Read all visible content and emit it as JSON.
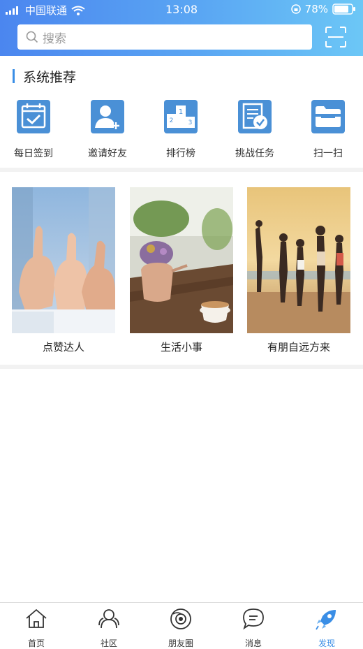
{
  "status": {
    "carrier": "中国联通",
    "time": "13:08",
    "battery": "78%"
  },
  "search": {
    "placeholder": "搜索"
  },
  "section": {
    "title": "系统推荐"
  },
  "features": [
    {
      "label": "每日签到",
      "icon": "calendar-check-icon"
    },
    {
      "label": "邀请好友",
      "icon": "add-user-icon"
    },
    {
      "label": "排行榜",
      "icon": "podium-icon"
    },
    {
      "label": "挑战任务",
      "icon": "task-document-icon"
    },
    {
      "label": "扫一扫",
      "icon": "scan-folder-icon"
    }
  ],
  "cards": [
    {
      "caption": "点赞达人"
    },
    {
      "caption": "生活小事"
    },
    {
      "caption": "有朋自远方来"
    }
  ],
  "tabs": [
    {
      "label": "首页",
      "icon": "home-icon"
    },
    {
      "label": "社区",
      "icon": "community-icon"
    },
    {
      "label": "朋友圈",
      "icon": "moments-icon"
    },
    {
      "label": "消息",
      "icon": "message-icon"
    },
    {
      "label": "发现",
      "icon": "discover-rocket-icon",
      "active": true
    }
  ],
  "colors": {
    "accent": "#3a8ee6",
    "header_start": "#4b86ef",
    "header_end": "#6cc7f6",
    "feature_icon": "#4a90d6"
  }
}
